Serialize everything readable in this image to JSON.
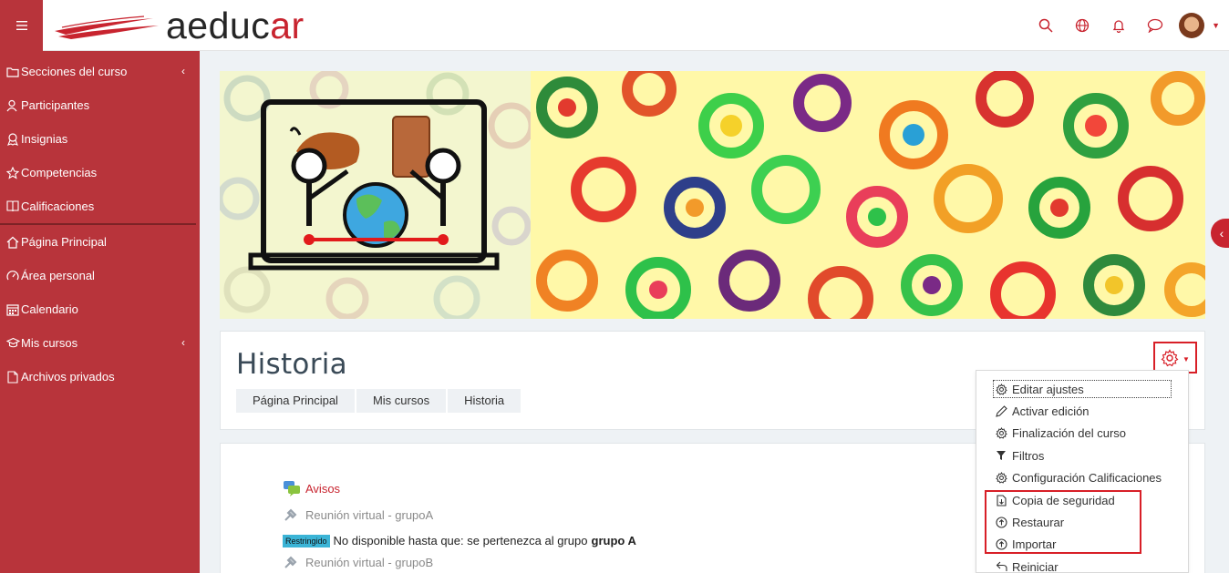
{
  "navbar": {
    "logo_text_main": "aeduc",
    "logo_text_accent": "ar",
    "menu_icon": "hamburger-icon",
    "icons": [
      "search-icon",
      "globe-icon",
      "bell-icon",
      "chat-icon",
      "avatar",
      "caret-down-icon"
    ],
    "brand_color": "#b8343b",
    "accent_color": "#c8242f"
  },
  "sidebar": {
    "items": [
      {
        "label": "Secciones del curso",
        "icon": "folder-icon"
      },
      {
        "label": "Participantes",
        "icon": "users-icon"
      },
      {
        "label": "Insignias",
        "icon": "badge-icon"
      },
      {
        "label": "Competencias",
        "icon": "star-icon"
      },
      {
        "label": "Calificaciones",
        "icon": "grades-icon"
      },
      {
        "label": "Página Principal",
        "icon": "home-icon"
      },
      {
        "label": "Área personal",
        "icon": "dashboard-icon"
      },
      {
        "label": "Calendario",
        "icon": "calendar-icon"
      },
      {
        "label": "Mis cursos",
        "icon": "graduation-cap-icon"
      },
      {
        "label": "Archivos privados",
        "icon": "file-icon"
      }
    ]
  },
  "course": {
    "title": "Historia",
    "breadcrumb": [
      "Página Principal",
      "Mis cursos",
      "Historia"
    ]
  },
  "settings_menu": {
    "items": [
      {
        "label": "Editar ajustes",
        "icon": "gear-icon"
      },
      {
        "label": "Activar edición",
        "icon": "pencil-icon"
      },
      {
        "label": "Finalización del curso",
        "icon": "gear-icon"
      },
      {
        "label": "Filtros",
        "icon": "filter-icon"
      },
      {
        "label": "Configuración Calificaciones",
        "icon": "gear-icon"
      },
      {
        "label": "Copia de seguridad",
        "icon": "backup-file-icon"
      },
      {
        "label": "Restaurar",
        "icon": "upload-circle-icon"
      },
      {
        "label": "Importar",
        "icon": "upload-circle-icon"
      },
      {
        "label": "Reiniciar",
        "icon": "undo-icon"
      }
    ]
  },
  "content": {
    "activities": [
      {
        "label": "Avisos",
        "icon": "forum-icon"
      },
      {
        "label": "Reunión virtual - grupoA",
        "icon": "plugin-icon"
      },
      {
        "label": "Reunión virtual - grupoB",
        "icon": "plugin-icon"
      }
    ],
    "restriction": {
      "badge": "Restringido",
      "text": "No disponible hasta que: se pertenezca al grupo",
      "group": "grupo A"
    }
  }
}
